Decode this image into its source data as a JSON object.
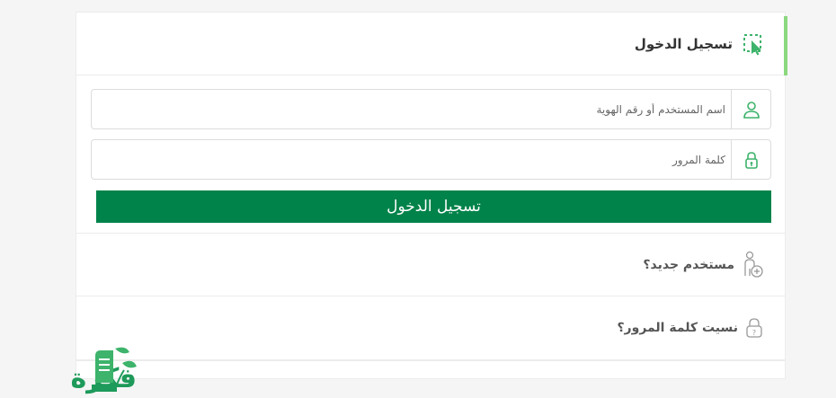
{
  "header": {
    "title": "تسجيل الدخول"
  },
  "form": {
    "username_placeholder": "اسم المستخدم أو رقم الهوية",
    "password_placeholder": "كلمة المرور",
    "submit_label": "تسجيل الدخول"
  },
  "links": {
    "new_user": "مستخدم جديد؟",
    "forgot_password": "نسيت كلمة المرور؟"
  },
  "logo": {
    "text": "فكرة"
  },
  "colors": {
    "primary": "#00834a",
    "accent": "#8bd87f",
    "icon": "#3db36b"
  }
}
